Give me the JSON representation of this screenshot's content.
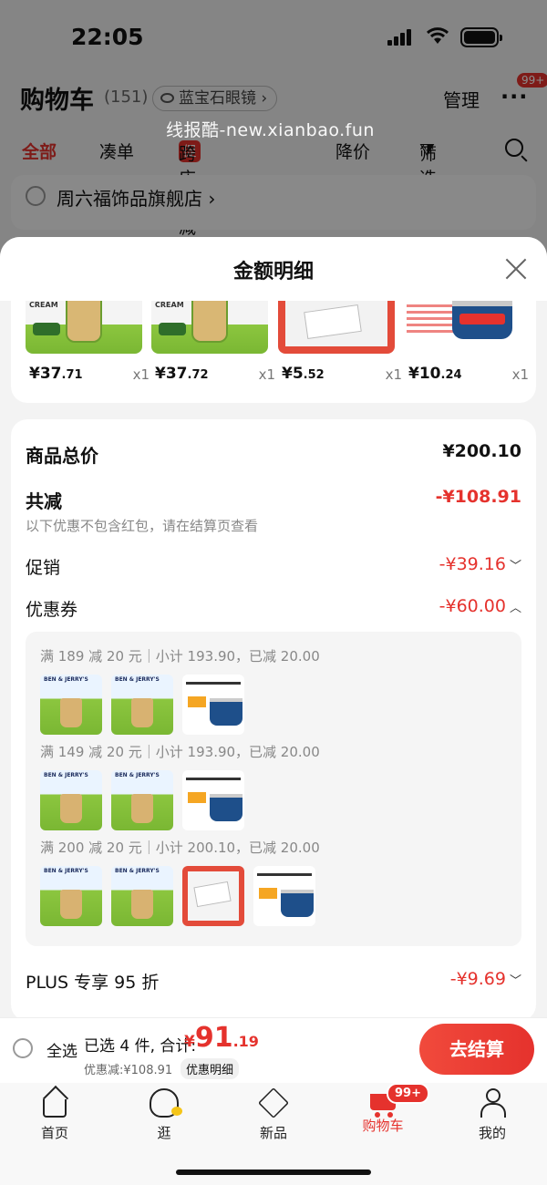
{
  "status_bar": {
    "time": "22:05"
  },
  "cart_header": {
    "title": "购物车",
    "count": "(151)",
    "eye_mode": "蓝宝石眼镜",
    "manage": "管理",
    "more_badge": "99+"
  },
  "watermark": "线报酷-new.xianbao.fun",
  "cart_tabs": {
    "all": "全部",
    "combine": "凑单",
    "cross_store_tag": "促",
    "cross_store": "跨店满减",
    "price_drop": "降价",
    "filter": "筛选"
  },
  "store": {
    "name": "周六福饰品旗舰店 ›"
  },
  "sheet": {
    "title": "金额明细"
  },
  "products": [
    {
      "yuan": "¥37",
      "cents": ".71",
      "qty": "x1",
      "image": "ben-jerrys-icecream"
    },
    {
      "yuan": "¥37",
      "cents": ".72",
      "qty": "x1",
      "image": "ben-jerrys-icecream"
    },
    {
      "yuan": "¥5",
      "cents": ".52",
      "qty": "x1",
      "image": "notebook-envelope"
    },
    {
      "yuan": "¥10",
      "cents": ".24",
      "qty": "x1",
      "image": "tuna-can"
    }
  ],
  "details": {
    "goods_total_label": "商品总价",
    "goods_total_value": "¥200.10",
    "total_discount_label": "共减",
    "total_discount_value": "-¥108.91",
    "note": "以下优惠不包含红包，请在结算页查看",
    "promo_label": "促销",
    "promo_value": "-¥39.16",
    "coupon_label": "优惠券",
    "coupon_value": "-¥60.00",
    "plus_label": "PLUS 专享 95 折",
    "plus_value": "-¥9.69"
  },
  "coupons": [
    {
      "text": "满 189 减 20 元｜小计 193.90，已减 20.00",
      "items": [
        "ice",
        "ice",
        "tuna"
      ]
    },
    {
      "text": "满 149 减 20 元｜小计 193.90，已减 20.00",
      "items": [
        "ice",
        "ice",
        "tuna"
      ]
    },
    {
      "text": "满 200 减 20 元｜小计 200.10，已减 20.00",
      "items": [
        "ice",
        "ice",
        "note",
        "tuna"
      ]
    }
  ],
  "bottom_bar": {
    "select_all": "全选",
    "selected_summary": "已选 4 件, 合计:",
    "total_yen": "¥",
    "total_int": "91",
    "total_dec": ".19",
    "discount_note": "优惠减:¥108.91",
    "discount_detail": "优惠明细",
    "checkout": "去结算"
  },
  "tabbar": {
    "home": "首页",
    "browse": "逛",
    "new": "新品",
    "cart": "购物车",
    "cart_badge": "99+",
    "me": "我的"
  },
  "colors": {
    "accent": "#e5322d",
    "sheet_bg": "#f3f3f3"
  }
}
